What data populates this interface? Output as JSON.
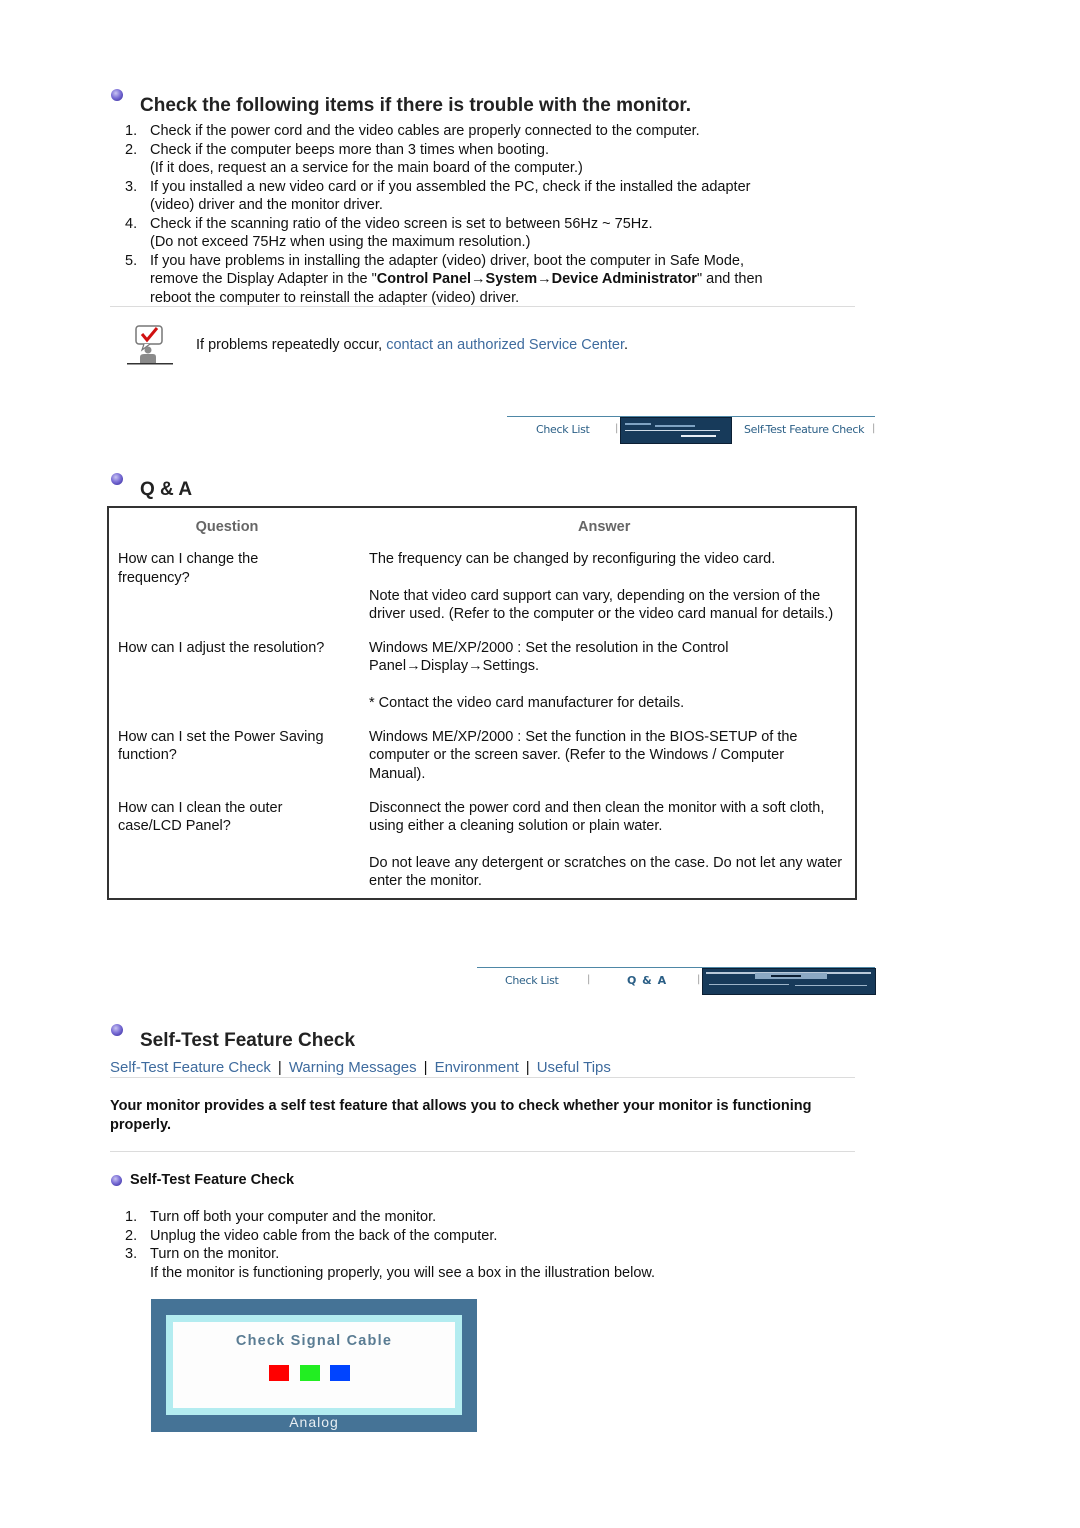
{
  "trouble": {
    "title": "Check the following items if there is trouble with the monitor.",
    "items": [
      {
        "num": "1.",
        "lines": [
          "Check if the power cord and the video cables are properly connected to the computer."
        ]
      },
      {
        "num": "2.",
        "lines": [
          "Check if the computer beeps more than 3 times when booting.",
          "(If it does, request an a service for the main board of the computer.)"
        ]
      },
      {
        "num": "3.",
        "lines": [
          "If you installed a new video card or if you assembled the PC, check if the installed the adapter",
          "(video) driver and the monitor driver."
        ]
      },
      {
        "num": "4.",
        "lines": [
          "Check if the scanning ratio of the video screen is set to between 56Hz ~ 75Hz.",
          "(Do not exceed 75Hz when using the maximum resolution.)"
        ]
      }
    ],
    "item5": {
      "num": "5.",
      "line1": "If you have problems in installing the adapter (video) driver, boot the computer in Safe Mode,",
      "line2_pre": "remove the Display Adapter in the \"",
      "line2_bold": "Control Panel→System→Device Administrator",
      "line2_post": "\" and then",
      "line3": "reboot the computer to reinstall the adapter (video) driver."
    },
    "note_prefix": "If problems repeatedly occur, ",
    "note_link": "contact an authorized Service Center",
    "note_suffix": "."
  },
  "nav1": {
    "check_list": "Check List",
    "self_test": "Self-Test Feature Check",
    "sep": "|"
  },
  "qa": {
    "title": "Q & A",
    "col_question": "Question",
    "col_answer": "Answer",
    "rows": [
      {
        "question": "How can I change the frequency?",
        "answers": [
          "The frequency can be changed by reconfiguring the video card.",
          "Note that video card support can vary, depending on the version of the driver used. (Refer to the computer or the video card manual for details.)"
        ]
      },
      {
        "question": "How can I adjust the resolution?",
        "answers": [
          "Windows ME/XP/2000 : Set the resolution in the Control Panel→Display→Settings.",
          "* Contact the video card manufacturer for details."
        ]
      },
      {
        "question": "How can I set the Power Saving function?",
        "answers": [
          "Windows ME/XP/2000 : Set the function in the BIOS-SETUP of the computer or the screen saver. (Refer to the Windows / Computer Manual)."
        ]
      },
      {
        "question": "How can I clean the outer case/LCD Panel?",
        "answers": [
          "Disconnect the power cord and then clean the monitor with a soft cloth, using either a cleaning solution or plain water.",
          "Do not leave any detergent or scratches on the case. Do not let any water enter the monitor."
        ]
      }
    ]
  },
  "nav2": {
    "check_list": "Check List",
    "qa": "Q & A",
    "sep": "|"
  },
  "selftest": {
    "title": "Self-Test Feature Check",
    "links": [
      "Self-Test Feature Check",
      "Warning Messages",
      "Environment",
      "Useful Tips"
    ],
    "sep": "|",
    "intro": "Your monitor provides a self test feature that allows you to check whether your monitor is functioning properly.",
    "subtitle": "Self-Test Feature Check",
    "steps": [
      {
        "num": "1.",
        "lines": [
          "Turn off both your computer and the monitor."
        ]
      },
      {
        "num": "2.",
        "lines": [
          "Unplug the video cable from the back of the computer."
        ]
      },
      {
        "num": "3.",
        "lines": [
          "Turn on the monitor.",
          "If the monitor is functioning properly, you will see a box in the illustration below."
        ]
      }
    ],
    "illustration": {
      "message": "Check Signal Cable",
      "mode": "Analog",
      "colors": [
        "#ff0000",
        "#22ee22",
        "#0044ff"
      ]
    }
  }
}
